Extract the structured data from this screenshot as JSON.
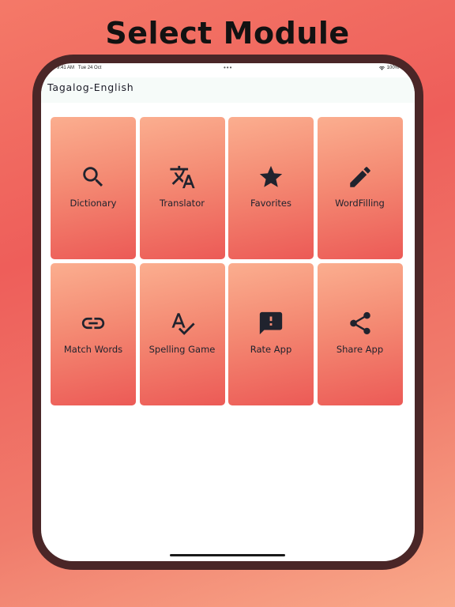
{
  "headline": "Select Module",
  "status_bar": {
    "time": "9:41 AM",
    "date": "Tue 24 Oct",
    "dots": "•••",
    "battery": "100%"
  },
  "app_bar": {
    "title": "Tagalog-English"
  },
  "modules": [
    {
      "label": "Dictionary",
      "icon": "search-icon"
    },
    {
      "label": "Translator",
      "icon": "translate-icon"
    },
    {
      "label": "Favorites",
      "icon": "star-icon"
    },
    {
      "label": "WordFilling",
      "icon": "pencil-icon"
    },
    {
      "label": "Match Words",
      "icon": "link-icon"
    },
    {
      "label": "Spelling Game",
      "icon": "spellcheck-icon"
    },
    {
      "label": "Rate App",
      "icon": "feedback-icon"
    },
    {
      "label": "Share App",
      "icon": "share-icon"
    }
  ],
  "colors": {
    "tile_top": "#fbae8f",
    "tile_bottom": "#ec5a56",
    "icon": "#20232e",
    "device_frame": "#4a2627",
    "app_bar": "#f6fbf9"
  }
}
